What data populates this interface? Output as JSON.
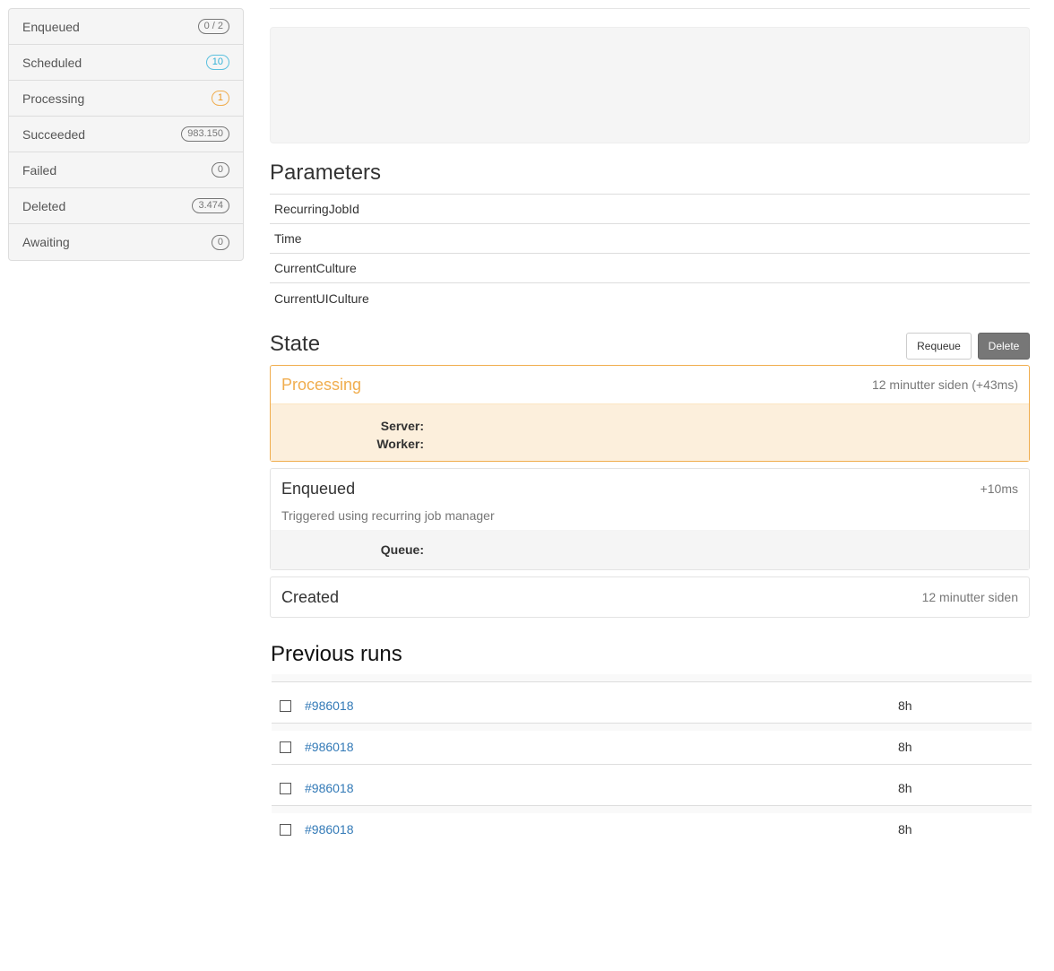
{
  "sidebar": {
    "items": [
      {
        "label": "Enqueued",
        "count": "0 / 2"
      },
      {
        "label": "Scheduled",
        "count": "10"
      },
      {
        "label": "Processing",
        "count": "1"
      },
      {
        "label": "Succeeded",
        "count": "983.150"
      },
      {
        "label": "Failed",
        "count": "0"
      },
      {
        "label": "Deleted",
        "count": "3.474"
      },
      {
        "label": "Awaiting",
        "count": "0"
      }
    ]
  },
  "parameters": {
    "title": "Parameters",
    "rows": [
      {
        "name": "RecurringJobId"
      },
      {
        "name": "Time"
      },
      {
        "name": "CurrentCulture"
      },
      {
        "name": "CurrentUICulture"
      }
    ]
  },
  "state": {
    "title": "State",
    "requeue_label": "Requeue",
    "delete_label": "Delete",
    "processing": {
      "title": "Processing",
      "time": "12 minutter siden (+43ms)",
      "server_label": "Server:",
      "worker_label": "Worker:"
    },
    "enqueued": {
      "title": "Enqueued",
      "time": "+10ms",
      "reason": "Triggered using recurring job manager",
      "queue_label": "Queue:"
    },
    "created": {
      "title": "Created",
      "time": "12 minutter siden"
    }
  },
  "previous_runs": {
    "title": "Previous runs",
    "rows": [
      {
        "id": "#986018",
        "age": "8h"
      },
      {
        "id": "#986018",
        "age": "8h"
      },
      {
        "id": "#986018",
        "age": "8h"
      },
      {
        "id": "#986018",
        "age": "8h"
      }
    ]
  },
  "colors": {
    "processing": "#f0ad4e",
    "info": "#5bc0de",
    "link": "#337ab7"
  }
}
